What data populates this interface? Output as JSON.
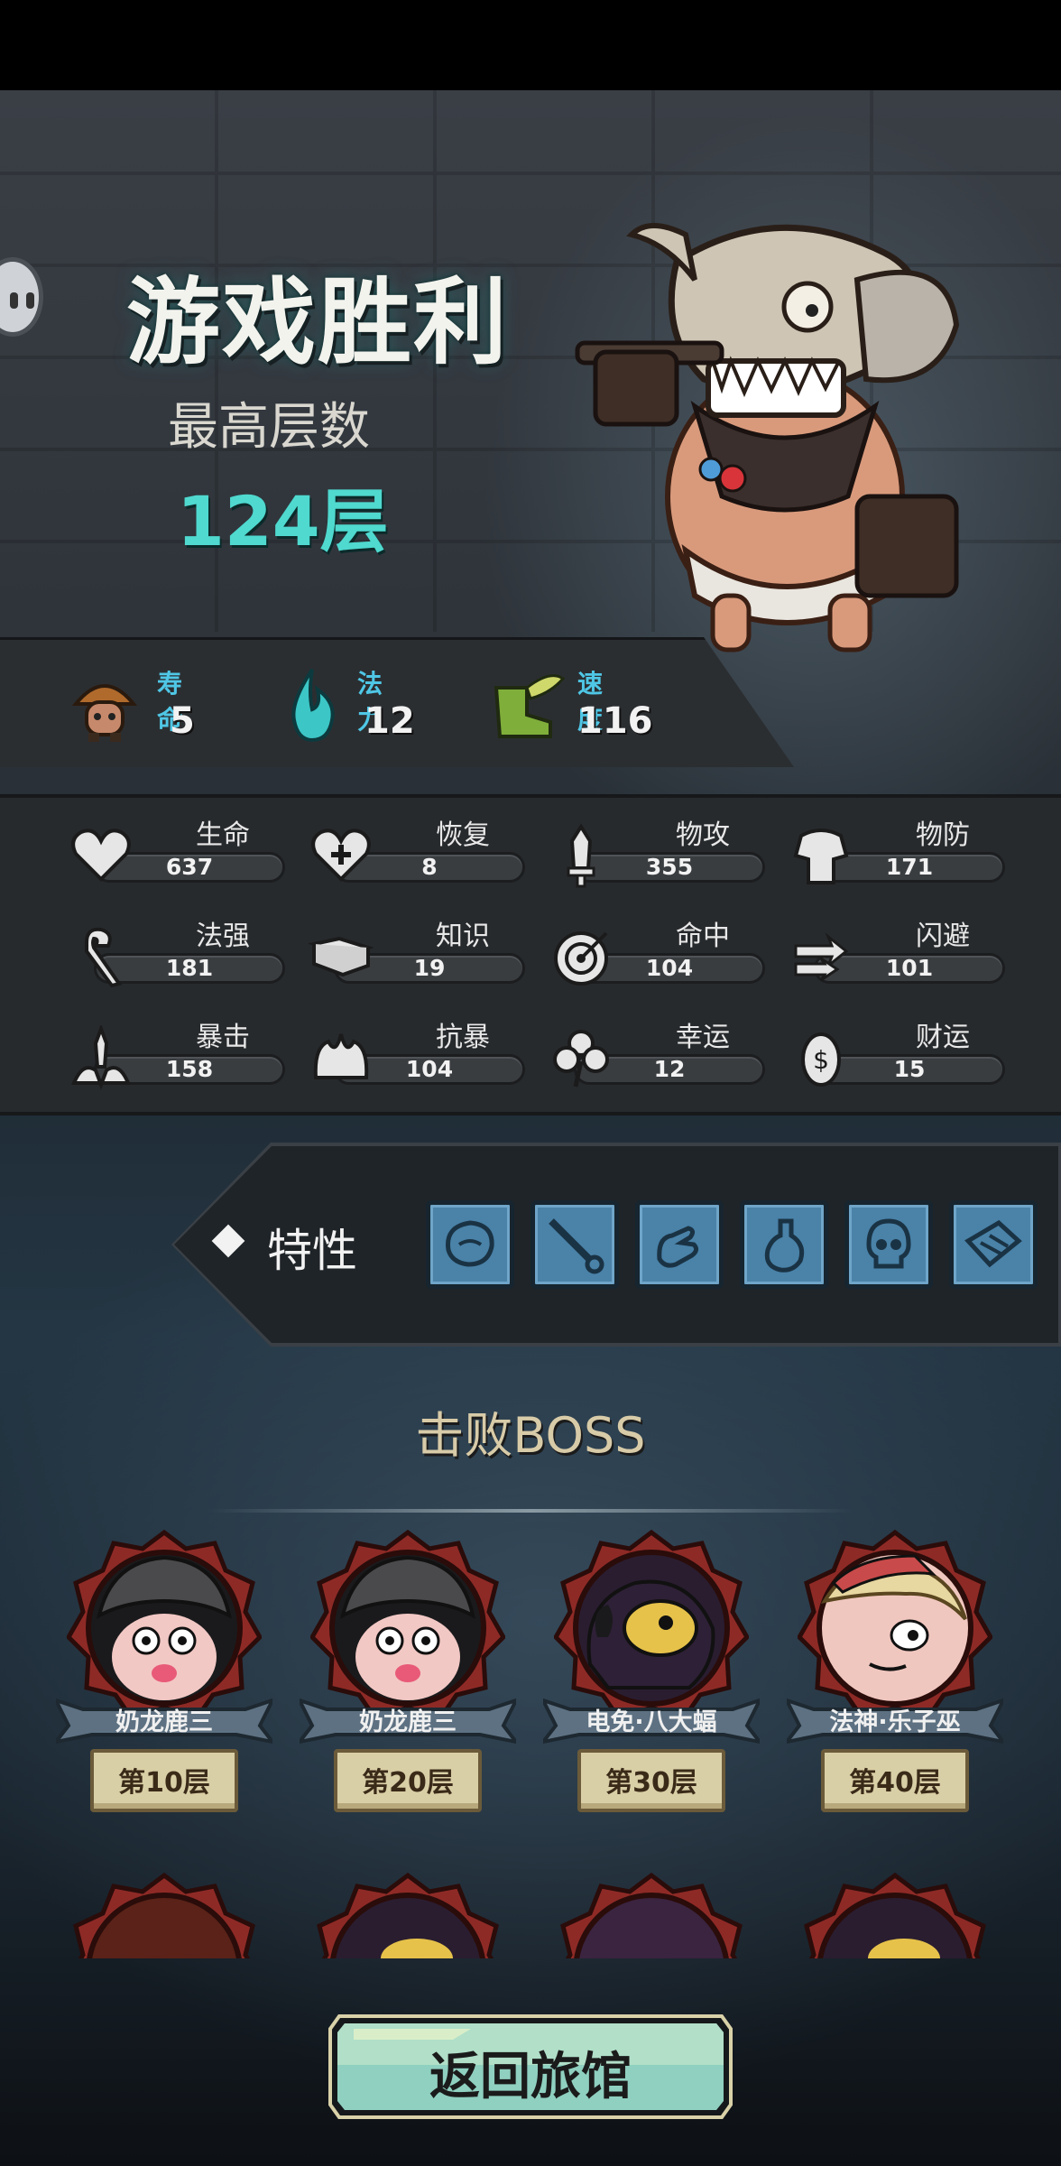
{
  "victory": {
    "title": "游戏胜利",
    "best_label": "最高层数",
    "best_value": "124层"
  },
  "top_stats": [
    {
      "label": "寿命",
      "value": "5",
      "icon": "mushroom-creature-icon"
    },
    {
      "label": "法力",
      "value": "12",
      "icon": "blue-flame-icon"
    },
    {
      "label": "速度",
      "value": "116",
      "icon": "winged-boot-icon"
    }
  ],
  "stats": [
    {
      "name": "生命",
      "value": "637",
      "icon": "heart-icon"
    },
    {
      "name": "恢复",
      "value": "8",
      "icon": "heart-plus-icon"
    },
    {
      "name": "物攻",
      "value": "355",
      "icon": "sword-icon"
    },
    {
      "name": "物防",
      "value": "171",
      "icon": "armor-icon"
    },
    {
      "name": "法强",
      "value": "181",
      "icon": "staff-icon"
    },
    {
      "name": "知识",
      "value": "19",
      "icon": "book-icon"
    },
    {
      "name": "命中",
      "value": "104",
      "icon": "target-icon"
    },
    {
      "name": "闪避",
      "value": "101",
      "icon": "dodge-arrows-icon"
    },
    {
      "name": "暴击",
      "value": "158",
      "icon": "crit-dagger-icon"
    },
    {
      "name": "抗暴",
      "value": "104",
      "icon": "shell-shield-icon"
    },
    {
      "name": "幸运",
      "value": "12",
      "icon": "clover-icon"
    },
    {
      "name": "财运",
      "value": "15",
      "icon": "coin-icon"
    }
  ],
  "traits": {
    "label": "特性",
    "slots": [
      "face-scribble-icon",
      "sword-slash-icon",
      "hand-icon",
      "potion-icon",
      "skull-icon",
      "scroll-icon"
    ]
  },
  "bosses": {
    "title": "击败BOSS",
    "items": [
      {
        "name": "奶龙鹿三",
        "floor": "第10层"
      },
      {
        "name": "奶龙鹿三",
        "floor": "第20层"
      },
      {
        "name": "电免·八大蝠",
        "floor": "第30层"
      },
      {
        "name": "法神·乐子巫",
        "floor": "第40层"
      }
    ]
  },
  "back_button": "返回旅馆",
  "colors": {
    "accent_teal": "#4fd9cf",
    "stat_label_blue": "#4fc7e6",
    "trait_slot": "#4a82a8",
    "boss_frame_red": "#8e2a26",
    "button_teal": "#8fd0c0"
  }
}
